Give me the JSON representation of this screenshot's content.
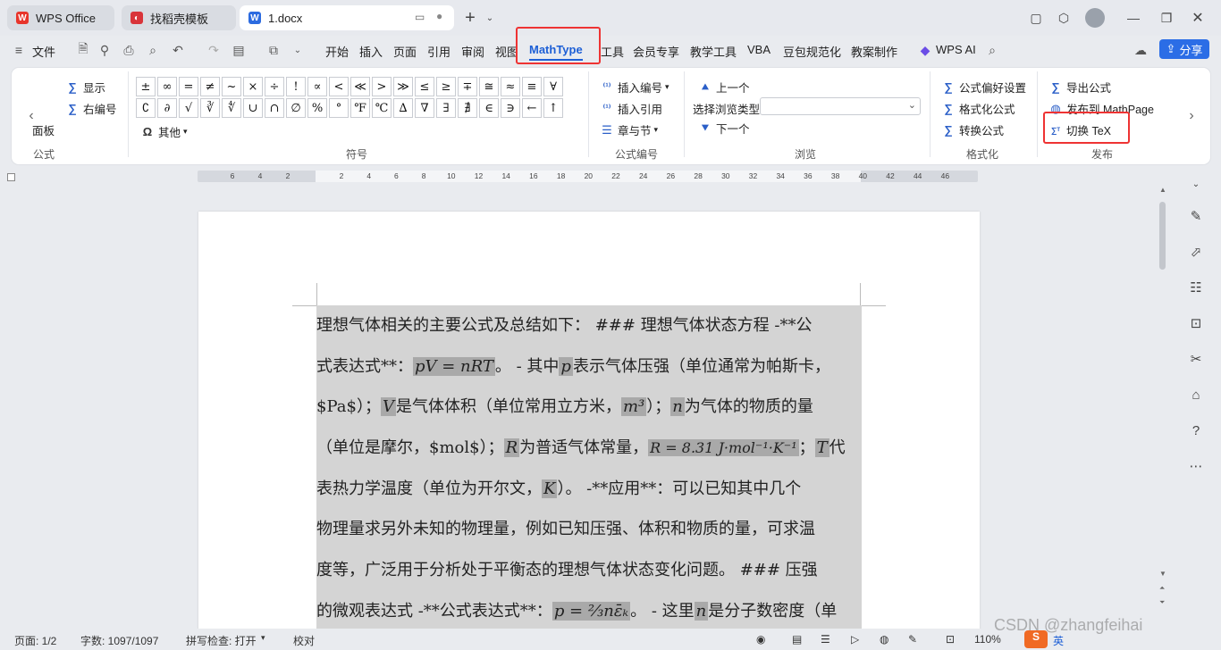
{
  "tabs": [
    {
      "label": "WPS Office"
    },
    {
      "label": "找稻壳模板"
    },
    {
      "label": "1.docx"
    }
  ],
  "menu": {
    "file": "文件",
    "items": [
      "开始",
      "插入",
      "页面",
      "引用",
      "审阅",
      "视图",
      "MathType",
      "工具",
      "会员专享",
      "教学工具",
      "VBA",
      "豆包规范化",
      "教案制作"
    ],
    "wps_ai": "WPS AI",
    "share": "分享"
  },
  "ribbon": {
    "left": {
      "show": "显示",
      "right_number": "右编号",
      "board": "面板",
      "style": "公式"
    },
    "symbols": [
      "±",
      "∞",
      "=",
      "≠",
      "~",
      "×",
      "÷",
      "!",
      "∝",
      "<",
      "≪",
      ">",
      "≫",
      "≤",
      "≥",
      "∓",
      "≅",
      "≈",
      "≡",
      "∀",
      "∁",
      "∂",
      "√",
      "∛",
      "∜",
      "∪",
      "∩",
      "∅",
      "%",
      "°",
      "℉",
      "℃",
      "∆",
      "∇",
      "∃",
      "∄",
      "∈",
      "∋",
      "←",
      "↑"
    ],
    "other": "其他",
    "group_symbols": "符号",
    "insert_number": "插入编号",
    "insert_ref": "插入引用",
    "chapter_section": "章与节",
    "group_formula_number": "公式编号",
    "prev": "上一个",
    "browse_type": "选择浏览类型",
    "next": "下一个",
    "group_browse": "浏览",
    "formula_pref": "公式偏好设置",
    "format_formula": "格式化公式",
    "convert_formula": "转换公式",
    "group_format": "格式化",
    "export_formula": "导出公式",
    "publish_mathpage": "发布到 MathPage",
    "toggle_tex": "切换 TeX",
    "group_publish": "发布"
  },
  "ruler_marks": [
    "6",
    "4",
    "2",
    "2",
    "4",
    "6",
    "8",
    "10",
    "12",
    "14",
    "16",
    "18",
    "20",
    "22",
    "24",
    "26",
    "28",
    "30",
    "32",
    "34",
    "36",
    "38",
    "40",
    "42",
    "44",
    "46"
  ],
  "document": {
    "lines": [
      "理想气体相关的主要公式及总结如下： ### 理想气体状态方程 -**公",
      "式表达式**：",
      "pV = nRT",
      "。 - 其中",
      "p",
      "表示气体压强（单位通常为帕斯卡，",
      "$Pa$）；",
      "V",
      "是气体体积（单位常用立方米，",
      "m³",
      "）；",
      "n",
      "为气体的物质的量",
      "（单位是摩尔，$mol$）；",
      "R",
      "为普适气体常量，",
      "R = 8.31 J·mol⁻¹·K⁻¹",
      "；",
      "T",
      "代",
      "表热力学温度（单位为开尔文，",
      "K",
      "）。 -**应用**：可以已知其中几个",
      "物理量求另外未知的物理量，例如已知压强、体积和物质的量，可求温",
      "度等，广泛用于分析处于平衡态的理想气体状态变化问题。 ### 压强",
      "的微观表达式 -**公式表达式**：",
      "p = ⅔nε̄ₖ",
      "。 - 这里",
      "n",
      "是分子数密度（单"
    ]
  },
  "status": {
    "page": "页面: 1/2",
    "words": "字数: 1097/1097",
    "spell": "拼写检查: 打开",
    "proof": "校对",
    "zoom": "110%",
    "ime": "英",
    "watermark": "CSDN @zhangfeihai"
  }
}
